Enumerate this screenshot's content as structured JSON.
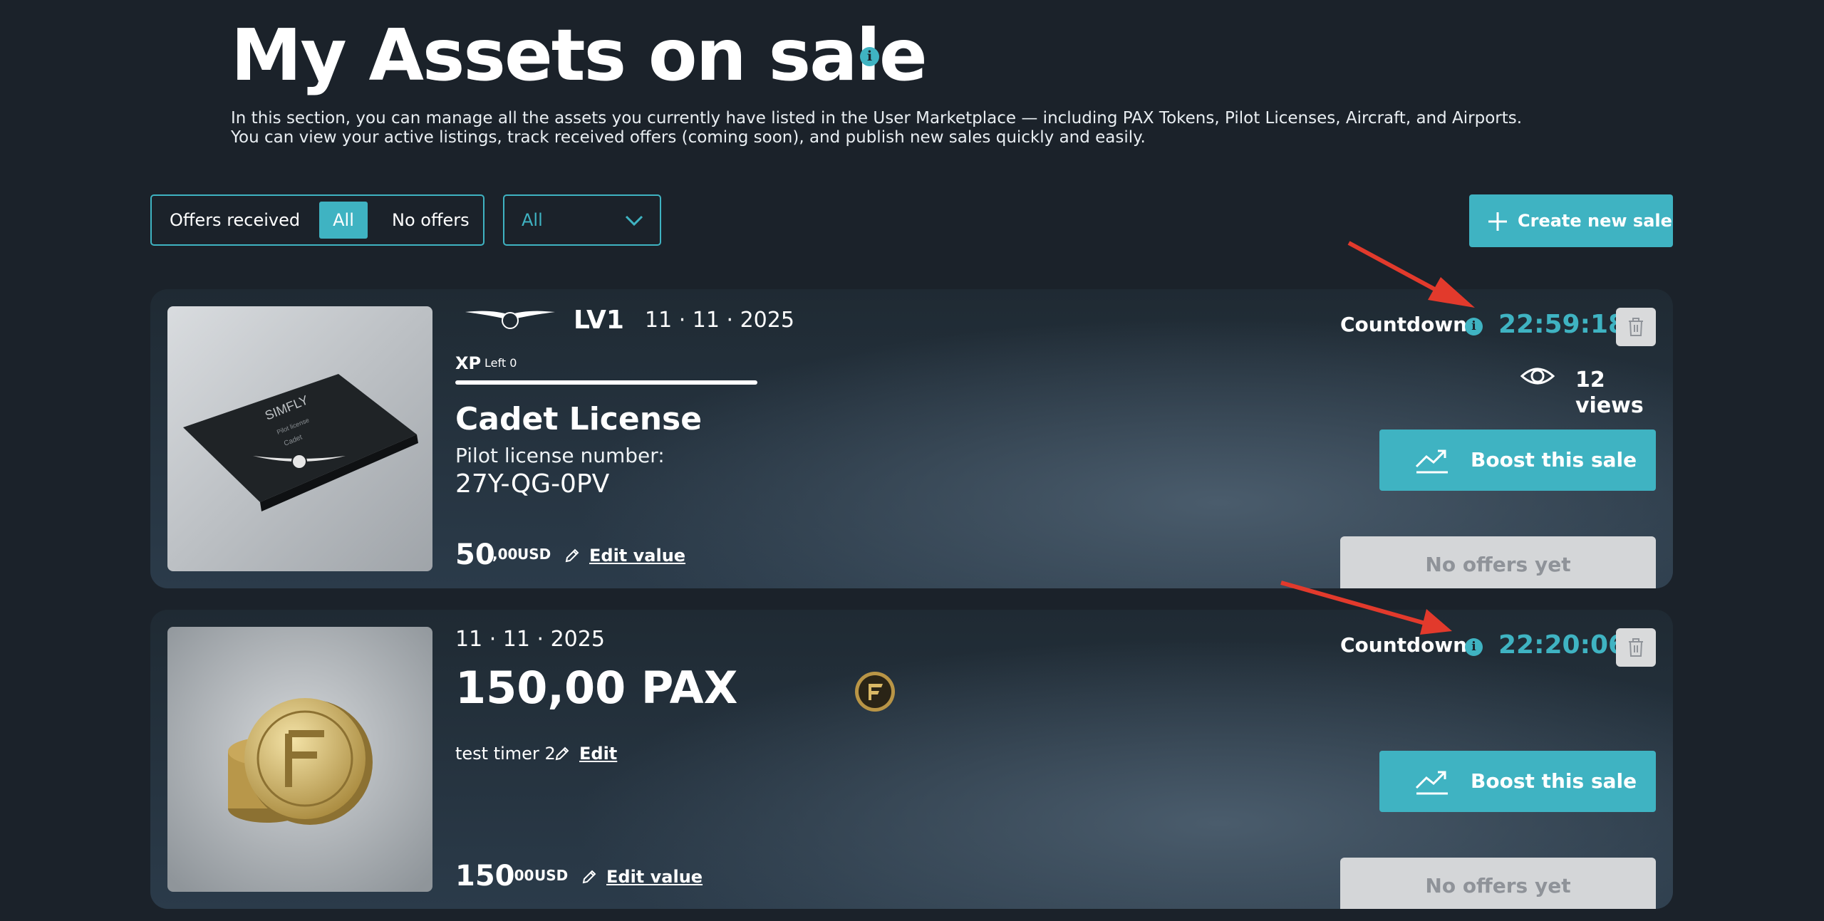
{
  "header": {
    "title": "My Assets on sale",
    "info_glyph": "i",
    "intro_line1": "In this section, you can manage all the assets you currently have listed in the User Marketplace — including PAX Tokens, Pilot Licenses, Aircraft, and Airports.",
    "intro_line2": "You can view your active listings, track received offers (coming soon), and publish new sales quickly and easily."
  },
  "filters": {
    "offers_label": "Offers received",
    "option_all": "All",
    "option_no_offers": "No offers",
    "type_selected": "All",
    "create_button": "Create new sale"
  },
  "listings": [
    {
      "tier": "LV1",
      "date": "11 · 11 · 2025",
      "xp_label": "XP",
      "xp_left": "Left 0",
      "name": "Cadet License",
      "meta_label": "Pilot license number:",
      "meta_value": "27Y-QG-0PV",
      "price_int": "50",
      "price_dec": ",00",
      "currency": "USD",
      "edit_value": "Edit value",
      "countdown_label": "Countdown",
      "countdown": "22:59:18",
      "views": "12 views",
      "boost": "Boost this sale",
      "no_offers": "No offers yet",
      "thumb_texts": [
        "SIMFLY",
        "Pilot license",
        "Cadet"
      ]
    },
    {
      "date": "11 · 11 · 2025",
      "amount": "150,00 PAX",
      "note": "test timer 2",
      "note_edit": "Edit",
      "price_int": "150",
      "price_dec": ",00",
      "currency": "USD",
      "edit_value": "Edit value",
      "countdown_label": "Countdown",
      "countdown": "22:20:06",
      "boost": "Boost this sale",
      "no_offers": "No offers yet"
    }
  ],
  "colors": {
    "background": "#1b222a",
    "accent": "#3fb3c2",
    "annotation_arrow": "#e23a2c",
    "disabled_button": "#d4d6d8"
  },
  "icons": [
    "info-icon",
    "chevron-down-icon",
    "plus-icon",
    "pilot-wings-icon",
    "pencil-icon",
    "trash-icon",
    "eye-icon",
    "trending-up-icon",
    "pax-coin-icon"
  ]
}
